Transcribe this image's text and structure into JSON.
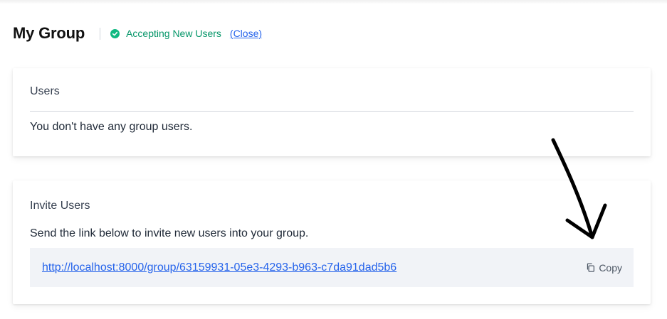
{
  "header": {
    "title": "My Group",
    "status_icon": "check-circle-icon",
    "status_text": "Accepting New Users",
    "close_label": "(Close)"
  },
  "users_card": {
    "title": "Users",
    "empty_message": "You don't have any group users."
  },
  "invite_card": {
    "title": "Invite Users",
    "description": "Send the link below to invite new users into your group.",
    "link": "http://localhost:8000/group/63159931-05e3-4293-b963-c7da91dad5b6",
    "copy_label": "Copy",
    "copy_icon": "copy-icon"
  },
  "annotation": {
    "arrow_icon": "hand-drawn-arrow-icon"
  },
  "colors": {
    "accent_green": "#059669",
    "link_blue": "#2563eb",
    "link_box_bg": "#f1f3f7"
  }
}
